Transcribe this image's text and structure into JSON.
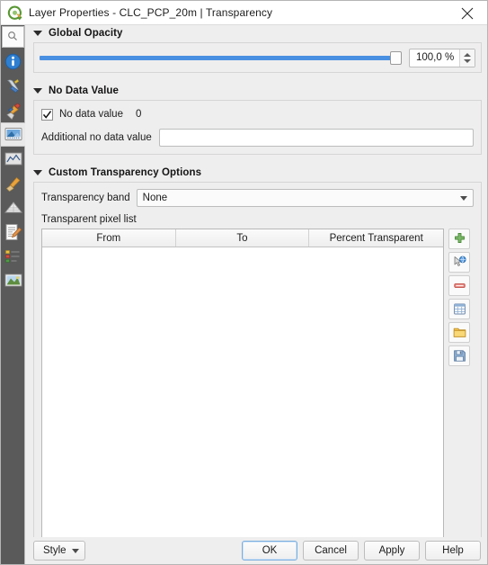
{
  "window": {
    "title": "Layer Properties - CLC_PCP_20m | Transparency",
    "app_icon": "qgis-logo-icon",
    "close_icon": "close-icon"
  },
  "sidebar": {
    "search_icon": "search-icon",
    "items": [
      {
        "name": "information",
        "icon": "information-icon",
        "selected": false
      },
      {
        "name": "source",
        "icon": "wrench-icon",
        "selected": false
      },
      {
        "name": "symbology",
        "icon": "paintbrush-icon",
        "selected": false
      },
      {
        "name": "transparency",
        "icon": "transparency-icon",
        "selected": true
      },
      {
        "name": "histogram",
        "icon": "histogram-icon",
        "selected": false
      },
      {
        "name": "rendering",
        "icon": "broom-icon",
        "selected": false
      },
      {
        "name": "pyramids",
        "icon": "pyramids-icon",
        "selected": false
      },
      {
        "name": "metadata",
        "icon": "document-pencil-icon",
        "selected": false
      },
      {
        "name": "legend",
        "icon": "legend-icon",
        "selected": false
      },
      {
        "name": "qgis-server",
        "icon": "map-image-icon",
        "selected": false
      }
    ]
  },
  "global_opacity": {
    "section_title": "Global Opacity",
    "slider_percent": 100,
    "value": "100,0 %"
  },
  "no_data_value": {
    "section_title": "No Data Value",
    "checkbox_label": "No data value",
    "checkbox_checked": true,
    "value": "0",
    "additional_label": "Additional no data value",
    "additional_value": "",
    "additional_placeholder": ""
  },
  "custom_transparency": {
    "section_title": "Custom Transparency Options",
    "band_label": "Transparency band",
    "band_value": "None",
    "pixel_list_label": "Transparent pixel list",
    "columns": [
      "From",
      "To",
      "Percent Transparent"
    ],
    "rows": [],
    "tools": [
      {
        "name": "add-values-manually-button",
        "icon": "green-plus-icon"
      },
      {
        "name": "add-values-from-display-button",
        "icon": "pointer-globe-icon"
      },
      {
        "name": "remove-selected-row-button",
        "icon": "red-minus-icon"
      },
      {
        "name": "default-values-button",
        "icon": "table-icon"
      },
      {
        "name": "import-from-file-button",
        "icon": "folder-icon"
      },
      {
        "name": "export-to-file-button",
        "icon": "floppy-disk-icon"
      }
    ]
  },
  "footer": {
    "style_label": "Style",
    "ok_label": "OK",
    "cancel_label": "Cancel",
    "apply_label": "Apply",
    "help_label": "Help"
  },
  "colors": {
    "accent": "#4a90e2",
    "sidebar_bg": "#5a5a5a",
    "dialog_bg": "#efeeee",
    "default_button_border": "#7aaedd"
  }
}
